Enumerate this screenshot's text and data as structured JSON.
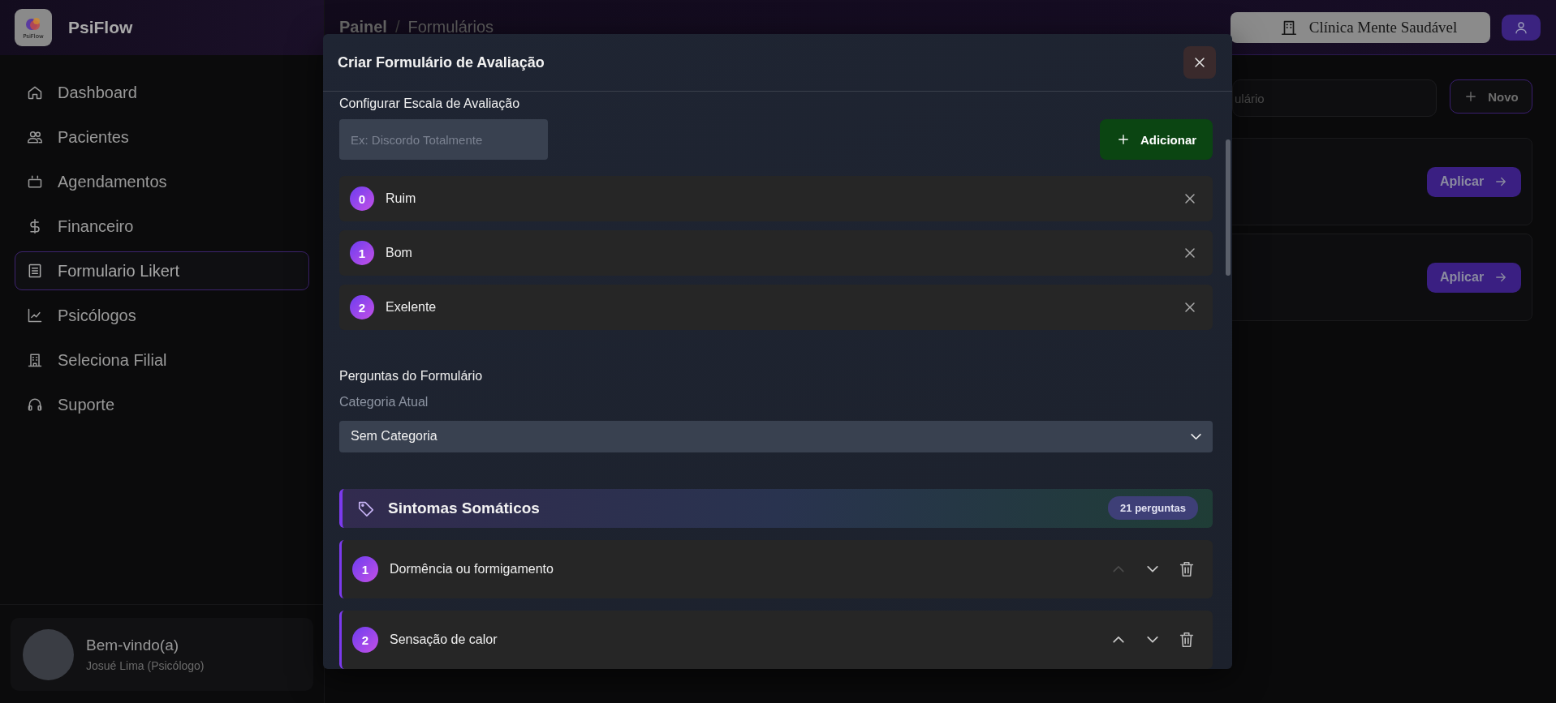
{
  "app": {
    "name": "PsiFlow",
    "logo_caption": "PsiFlow"
  },
  "sidebar": {
    "items": [
      {
        "label": "Dashboard",
        "selected": false
      },
      {
        "label": "Pacientes",
        "selected": false
      },
      {
        "label": "Agendamentos",
        "selected": false
      },
      {
        "label": "Financeiro",
        "selected": false
      },
      {
        "label": "Formulario Likert",
        "selected": true
      },
      {
        "label": "Psicólogos",
        "selected": false
      },
      {
        "label": "Seleciona Filial",
        "selected": false
      },
      {
        "label": "Suporte",
        "selected": false
      }
    ],
    "user": {
      "greeting": "Bem-vindo(a)",
      "name": "Josué Lima (Psicólogo)"
    }
  },
  "header": {
    "breadcrumb": [
      "Painel",
      "/",
      "Formulários"
    ],
    "clinic": "Clínica Mente Saudável"
  },
  "background": {
    "search": {
      "placeholder": "ulário"
    },
    "new_button": "Novo",
    "cards": [
      {
        "button": "Aplicar"
      },
      {
        "button": "Aplicar"
      }
    ]
  },
  "modal": {
    "title": "Criar Formulário de Avaliação",
    "scale": {
      "heading": "Configurar Escala de Avaliação",
      "input": {
        "placeholder": "Ex: Discordo Totalmente"
      },
      "add_button": "Adicionar",
      "options": [
        {
          "value": "0",
          "label": "Ruim"
        },
        {
          "value": "1",
          "label": "Bom"
        },
        {
          "value": "2",
          "label": "Exelente"
        }
      ]
    },
    "questions": {
      "heading": "Perguntas do Formulário",
      "category_label": "Categoria Atual",
      "category_select": "Sem Categoria",
      "groups": [
        {
          "name": "Sintomas Somáticos",
          "count": "21 perguntas",
          "items": [
            {
              "number": "1",
              "text": "Dormência ou formigamento",
              "up_disabled": true
            },
            {
              "number": "2",
              "text": "Sensação de calor",
              "up_disabled": false
            }
          ]
        }
      ]
    }
  }
}
